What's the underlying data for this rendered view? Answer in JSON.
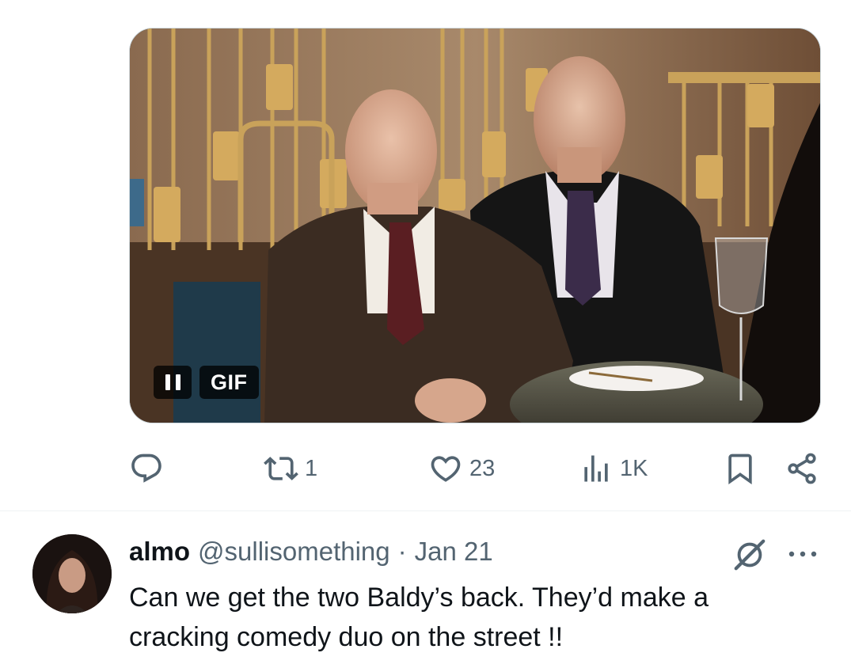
{
  "media": {
    "gif_label": "GIF",
    "pause_icon": "pause-icon"
  },
  "actions": {
    "reply": {
      "icon": "reply-icon",
      "count": ""
    },
    "repost": {
      "icon": "repost-icon",
      "count": "1"
    },
    "like": {
      "icon": "heart-icon",
      "count": "23"
    },
    "views": {
      "icon": "analytics-icon",
      "count": "1K"
    },
    "bookmark": {
      "icon": "bookmark-icon"
    },
    "share": {
      "icon": "share-icon"
    }
  },
  "reply_tweet": {
    "name": "almo",
    "handle": "@sullisomething",
    "separator": "·",
    "date": "Jan 21",
    "text": "Can we get the two Baldy’s back. They’d make a cracking comedy duo on the street !!",
    "icons": [
      "grok-icon",
      "more-icon"
    ]
  },
  "colors": {
    "secondary_text": "#536471",
    "primary_text": "#0f1419",
    "divider": "#eff3f4"
  }
}
